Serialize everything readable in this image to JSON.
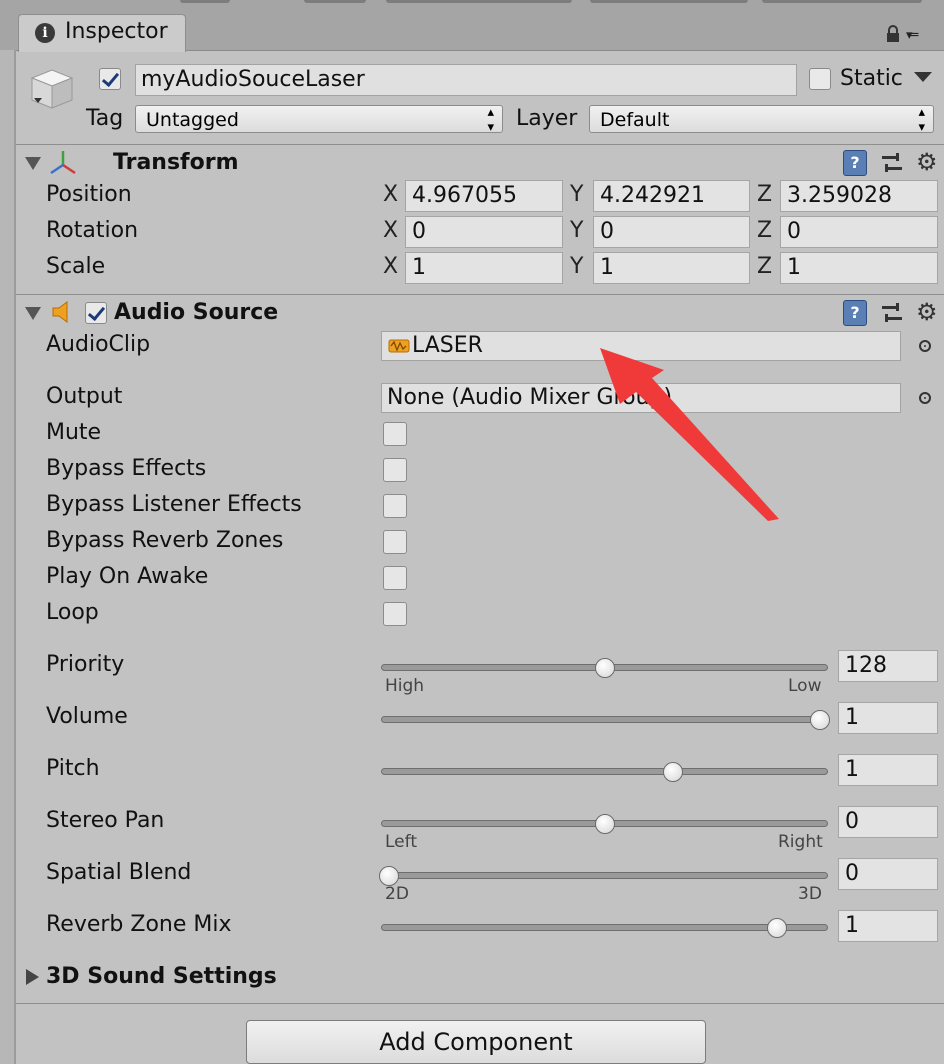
{
  "tab": {
    "title": "Inspector",
    "icon": "info-icon"
  },
  "header": {
    "object_name": "myAudioSouceLaser",
    "active": true,
    "static_label": "Static",
    "static_checked": false,
    "tag_label": "Tag",
    "tag_value": "Untagged",
    "layer_label": "Layer",
    "layer_value": "Default"
  },
  "transform": {
    "title": "Transform",
    "axes": {
      "x": "X",
      "y": "Y",
      "z": "Z"
    },
    "position": {
      "label": "Position",
      "x": "4.967055",
      "y": "4.242921",
      "z": "3.259028"
    },
    "rotation": {
      "label": "Rotation",
      "x": "0",
      "y": "0",
      "z": "0"
    },
    "scale": {
      "label": "Scale",
      "x": "1",
      "y": "1",
      "z": "1"
    }
  },
  "audio_source": {
    "title": "Audio Source",
    "enabled": true,
    "audioclip": {
      "label": "AudioClip",
      "value": "LASER"
    },
    "output": {
      "label": "Output",
      "value": "None (Audio Mixer Group)"
    },
    "toggles": [
      {
        "label": "Mute",
        "checked": false
      },
      {
        "label": "Bypass Effects",
        "checked": false
      },
      {
        "label": "Bypass Listener Effects",
        "checked": false
      },
      {
        "label": "Bypass Reverb Zones",
        "checked": false
      },
      {
        "label": "Play On Awake",
        "checked": false
      },
      {
        "label": "Loop",
        "checked": false
      }
    ],
    "sliders": [
      {
        "label": "Priority",
        "value": "128",
        "position": 0.5,
        "min_label": "High",
        "max_label": "Low"
      },
      {
        "label": "Volume",
        "value": "1",
        "position": 1.0
      },
      {
        "label": "Pitch",
        "value": "1",
        "position": 0.66
      },
      {
        "label": "Stereo Pan",
        "value": "0",
        "position": 0.5,
        "min_label": "Left",
        "max_label": "Right"
      },
      {
        "label": "Spatial Blend",
        "value": "0",
        "position": 0.0,
        "min_label": "2D",
        "max_label": "3D"
      },
      {
        "label": "Reverb Zone Mix",
        "value": "1",
        "position": 0.9
      }
    ],
    "sound_settings_label": "3D Sound Settings"
  },
  "add_component_label": "Add Component",
  "colors": {
    "panel": "#c2c2c2",
    "annotation_arrow": "#f03a3a",
    "audio_icon": "#f0a020"
  }
}
